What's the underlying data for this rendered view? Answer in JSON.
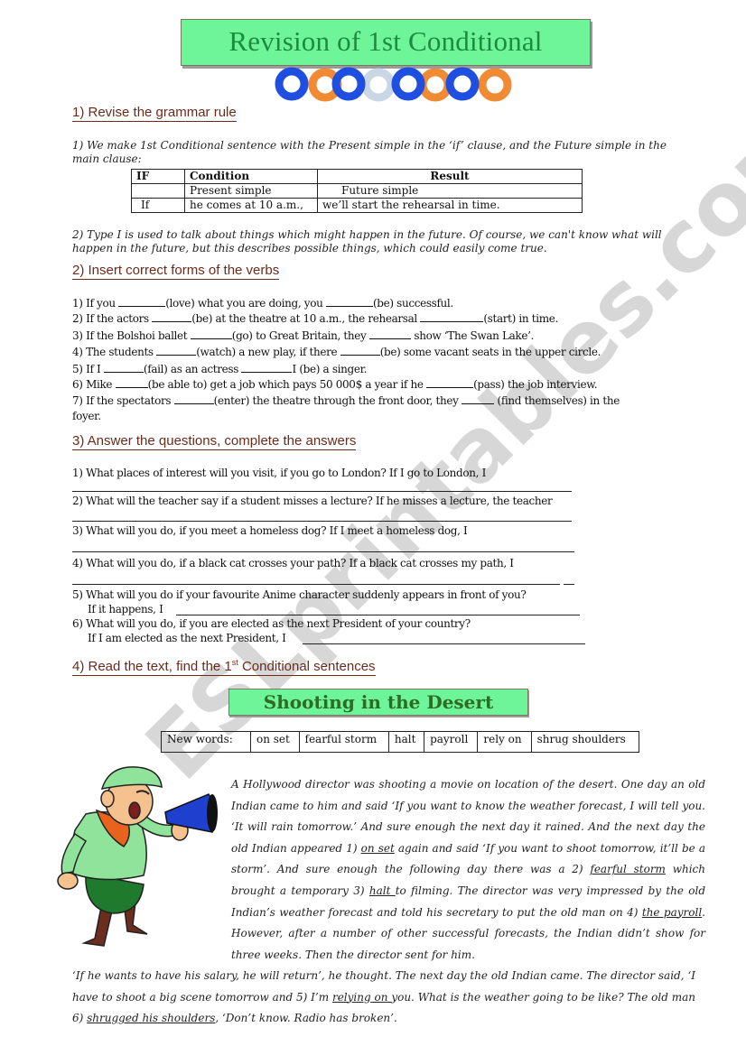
{
  "title": "Revision of 1st Conditional",
  "decoration": {
    "rings": [
      "blue",
      "orange",
      "blue",
      "silver",
      "blue",
      "orange",
      "blue",
      "orange"
    ],
    "colors": {
      "blue": "#1f4fe0",
      "orange": "#f08a33",
      "silver": "#c9d6e3",
      "title_bg": "#6ef59a",
      "title_fg": "#1e8a3e",
      "heading": "#6b2b1b"
    }
  },
  "section1": {
    "heading": "1)   Revise the grammar rule",
    "rule1": "1) We make 1st Conditional sentence with the Present simple in the ‘if’ clause, and the Future simple in the main clause:",
    "table": {
      "headers": [
        "IF",
        "Condition",
        "Result"
      ],
      "rows": [
        [
          "",
          "Present simple",
          "Future simple"
        ],
        [
          "If",
          "he comes at 10 a.m.,",
          "we’ll start the rehearsal in time."
        ]
      ]
    },
    "rule2": "2) Type I is used to talk about things which might happen in the future. Of course, we can't know what will happen in the future, but this describes possible things, which could easily come true."
  },
  "section2": {
    "heading": "2)  Insert correct forms of the verbs",
    "items": [
      [
        "1)  If you ",
        "(love) what you are doing, you ",
        "(be) successful."
      ],
      [
        " 2)  If the actors ",
        "(be) at the theatre at 10 a.m., the rehearsal  ",
        "(start) in time."
      ],
      [
        " 3)  If the Bolshoi ballet ",
        "(go) to Great Britain, they ",
        "  show  ‘The Swan Lake’."
      ],
      [
        " 4) The students ",
        "(watch) a new play, if there ",
        "(be) some vacant seats in the upper circle."
      ],
      [
        " 5)  If I ",
        "(fail) as an actress ",
        "I  (be) a singer."
      ],
      [
        " 6)  Mike ",
        "(be able to) get a job which pays 50 000$ a year if he  ",
        "(pass) the job interview."
      ],
      [
        " 7)  If the spectators ",
        "(enter) the theatre through the front  door,  they ",
        " (find themselves)  in the"
      ]
    ],
    "item7_cont": "foyer."
  },
  "section3": {
    "heading": "3)  Answer the questions, complete the answers",
    "questions": [
      "1)  What places of interest will you visit, if you go to London?   If I go to London, I",
      "2)  What will the teacher say if a student misses a lecture?   If he misses a lecture, the teacher",
      "3)  What will you do, if you meet a homeless dog?     If I meet a homeless dog, I",
      "4)  What will you do, if a black cat crosses your path?     If a black cat crosses my path, I",
      "5)  What will you do if your favourite Anime character suddenly appears in front of you?",
      "6)  What will you do, if you are elected as the next President of your country?"
    ],
    "answer5": "If it happens, I",
    "answer6": "If I am elected as the next President, I"
  },
  "section4": {
    "heading_pre": "4)  Read the text, find the 1",
    "heading_sup": "st",
    "heading_post": " Conditional sentences",
    "story_title": "Shooting in the Desert",
    "new_words_label": "New words:",
    "new_words": [
      "on set",
      "fearful storm",
      "halt",
      "payroll",
      "rely on",
      "shrug shoulders"
    ],
    "illustration": "cartoon director shouting into megaphone",
    "story": {
      "p1": "A Hollywood director was shooting a movie on location of the desert. One day an old Indian came to him and said ‘If you want to know the weather forecast, I will tell you. ‘It will rain tomorrow.’ And sure enough the next day it rained. And the next day the old Indian appeared 1) ",
      "u1": "on set",
      "p2": " again and said ‘If you want to shoot tomorrow, it’ll be a storm’.  And sure enough the following day there was a 2) ",
      "u2": "fearful storm",
      "p3": " which brought a temporary 3) ",
      "u3": "halt ",
      "p4": "to filming. The director was very impressed by the old Indian’s weather forecast and told his secretary to put the old man on 4) ",
      "u4": "the payroll",
      "p5": ". However, after a number of other successful forecasts, the Indian didn’t show for three weeks. Then the director sent for him.",
      "p6": "‘If he wants to have his salary, he will return’, he thought.  The next day the old Indian came. The director said, ‘I have to shoot a big scene tomorrow and 5) I’m ",
      "u5": "relying on ",
      "p7": "you. What is the weather going to be like? The old man 6) ",
      "u6": "shrugged his shoulders",
      "p8": ", ‘Don’t know. Radio has broken’."
    }
  },
  "watermark": "ESLprintables.com"
}
